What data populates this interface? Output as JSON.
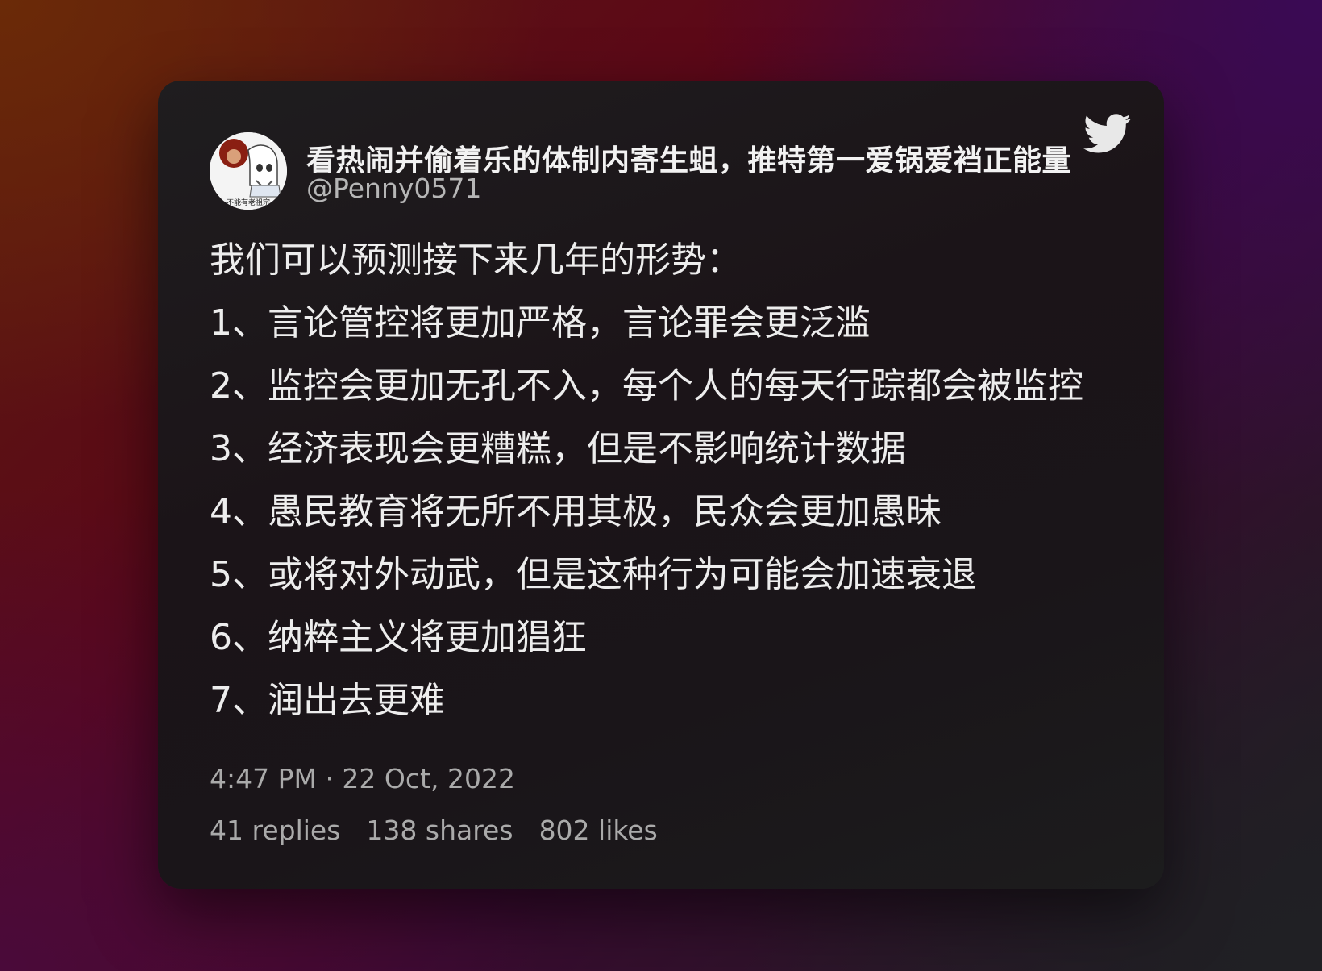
{
  "tweet": {
    "display_name": "看热闹并偷着乐的体制内寄生蛆，推特第一爱锅爱裆正能量",
    "handle": "@Penny0571",
    "avatar_text": "不能有老祖宗",
    "lines": [
      "我们可以预测接下来几年的形势：",
      "1、言论管控将更加严格，言论罪会更泛滥",
      "2、监控会更加无孔不入，每个人的每天行踪都会被监控",
      "3、经济表现会更糟糕，但是不影响统计数据",
      "4、愚民教育将无所不用其极，民众会更加愚昧",
      "5、或将对外动武，但是这种行为可能会加速衰退",
      "6、纳粹主义将更加猖狂",
      "7、润出去更难"
    ],
    "timestamp": "4:47 PM · 22 Oct, 2022",
    "replies": "41 replies",
    "shares": "138 shares",
    "likes": "802 likes"
  },
  "icons": {
    "brand": "twitter-bird-icon",
    "avatar": "anime-avatar-icon"
  },
  "colors": {
    "card_background": "#1c1a1c",
    "primary_text": "#ededed",
    "secondary_text": "#aaaaaa",
    "icon": "#e8e8e8"
  }
}
